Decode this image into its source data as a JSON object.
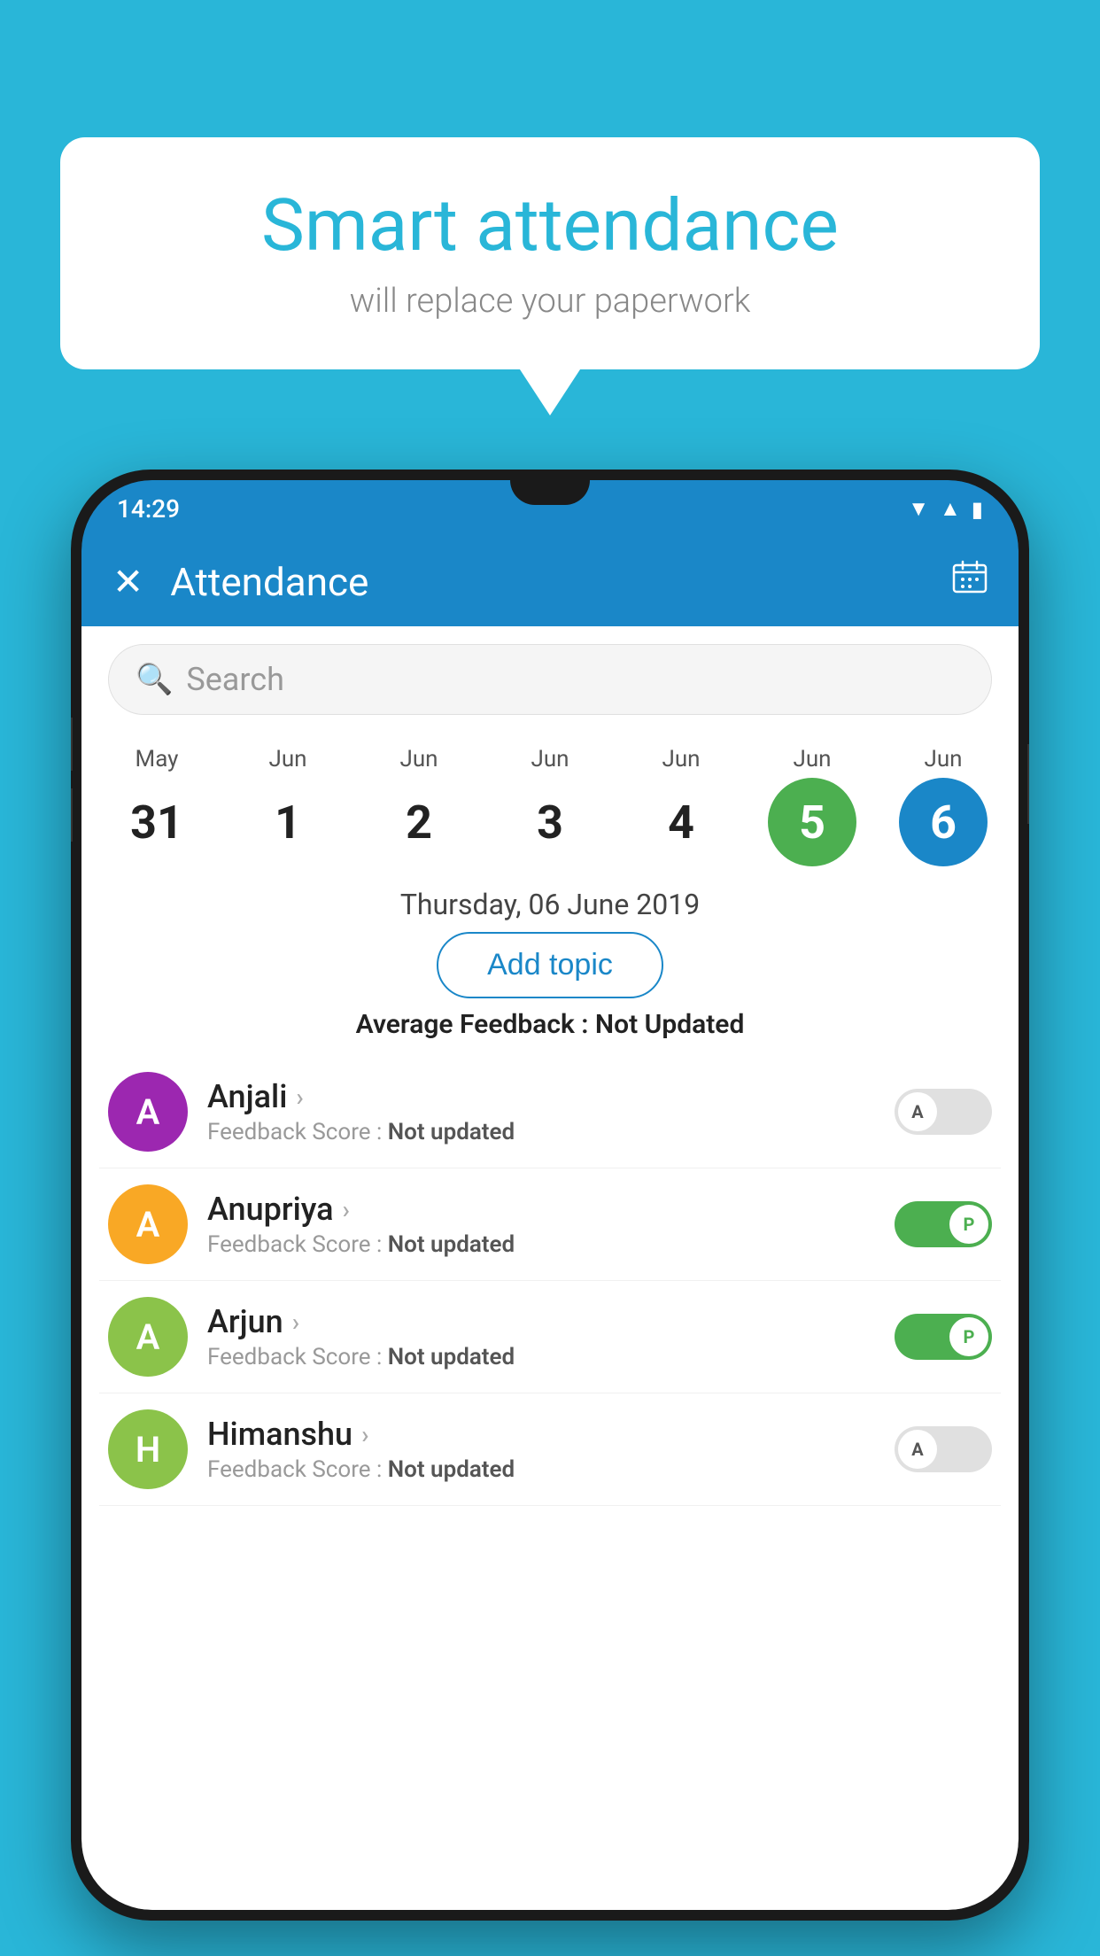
{
  "background_color": "#29b6d8",
  "bubble": {
    "title": "Smart attendance",
    "subtitle": "will replace your paperwork"
  },
  "status_bar": {
    "time": "14:29"
  },
  "app_bar": {
    "title": "Attendance",
    "close_label": "×",
    "calendar_label": "📅"
  },
  "search": {
    "placeholder": "Search"
  },
  "date_strip": {
    "dates": [
      {
        "month": "May",
        "day": "31",
        "style": "normal"
      },
      {
        "month": "Jun",
        "day": "1",
        "style": "normal"
      },
      {
        "month": "Jun",
        "day": "2",
        "style": "normal"
      },
      {
        "month": "Jun",
        "day": "3",
        "style": "normal"
      },
      {
        "month": "Jun",
        "day": "4",
        "style": "normal"
      },
      {
        "month": "Jun",
        "day": "5",
        "style": "green"
      },
      {
        "month": "Jun",
        "day": "6",
        "style": "blue"
      }
    ]
  },
  "selected_date": "Thursday, 06 June 2019",
  "add_topic_label": "Add topic",
  "avg_feedback_label": "Average Feedback :",
  "avg_feedback_value": "Not Updated",
  "students": [
    {
      "name": "Anjali",
      "avatar_letter": "A",
      "avatar_color": "#9c27b0",
      "feedback_label": "Feedback Score :",
      "feedback_value": "Not updated",
      "toggle": "off",
      "toggle_letter": "A"
    },
    {
      "name": "Anupriya",
      "avatar_letter": "A",
      "avatar_color": "#f9a825",
      "feedback_label": "Feedback Score :",
      "feedback_value": "Not updated",
      "toggle": "on",
      "toggle_letter": "P"
    },
    {
      "name": "Arjun",
      "avatar_letter": "A",
      "avatar_color": "#8bc34a",
      "feedback_label": "Feedback Score :",
      "feedback_value": "Not updated",
      "toggle": "on",
      "toggle_letter": "P"
    },
    {
      "name": "Himanshu",
      "avatar_letter": "H",
      "avatar_color": "#8bc34a",
      "feedback_label": "Feedback Score :",
      "feedback_value": "Not updated",
      "toggle": "off",
      "toggle_letter": "A"
    }
  ]
}
